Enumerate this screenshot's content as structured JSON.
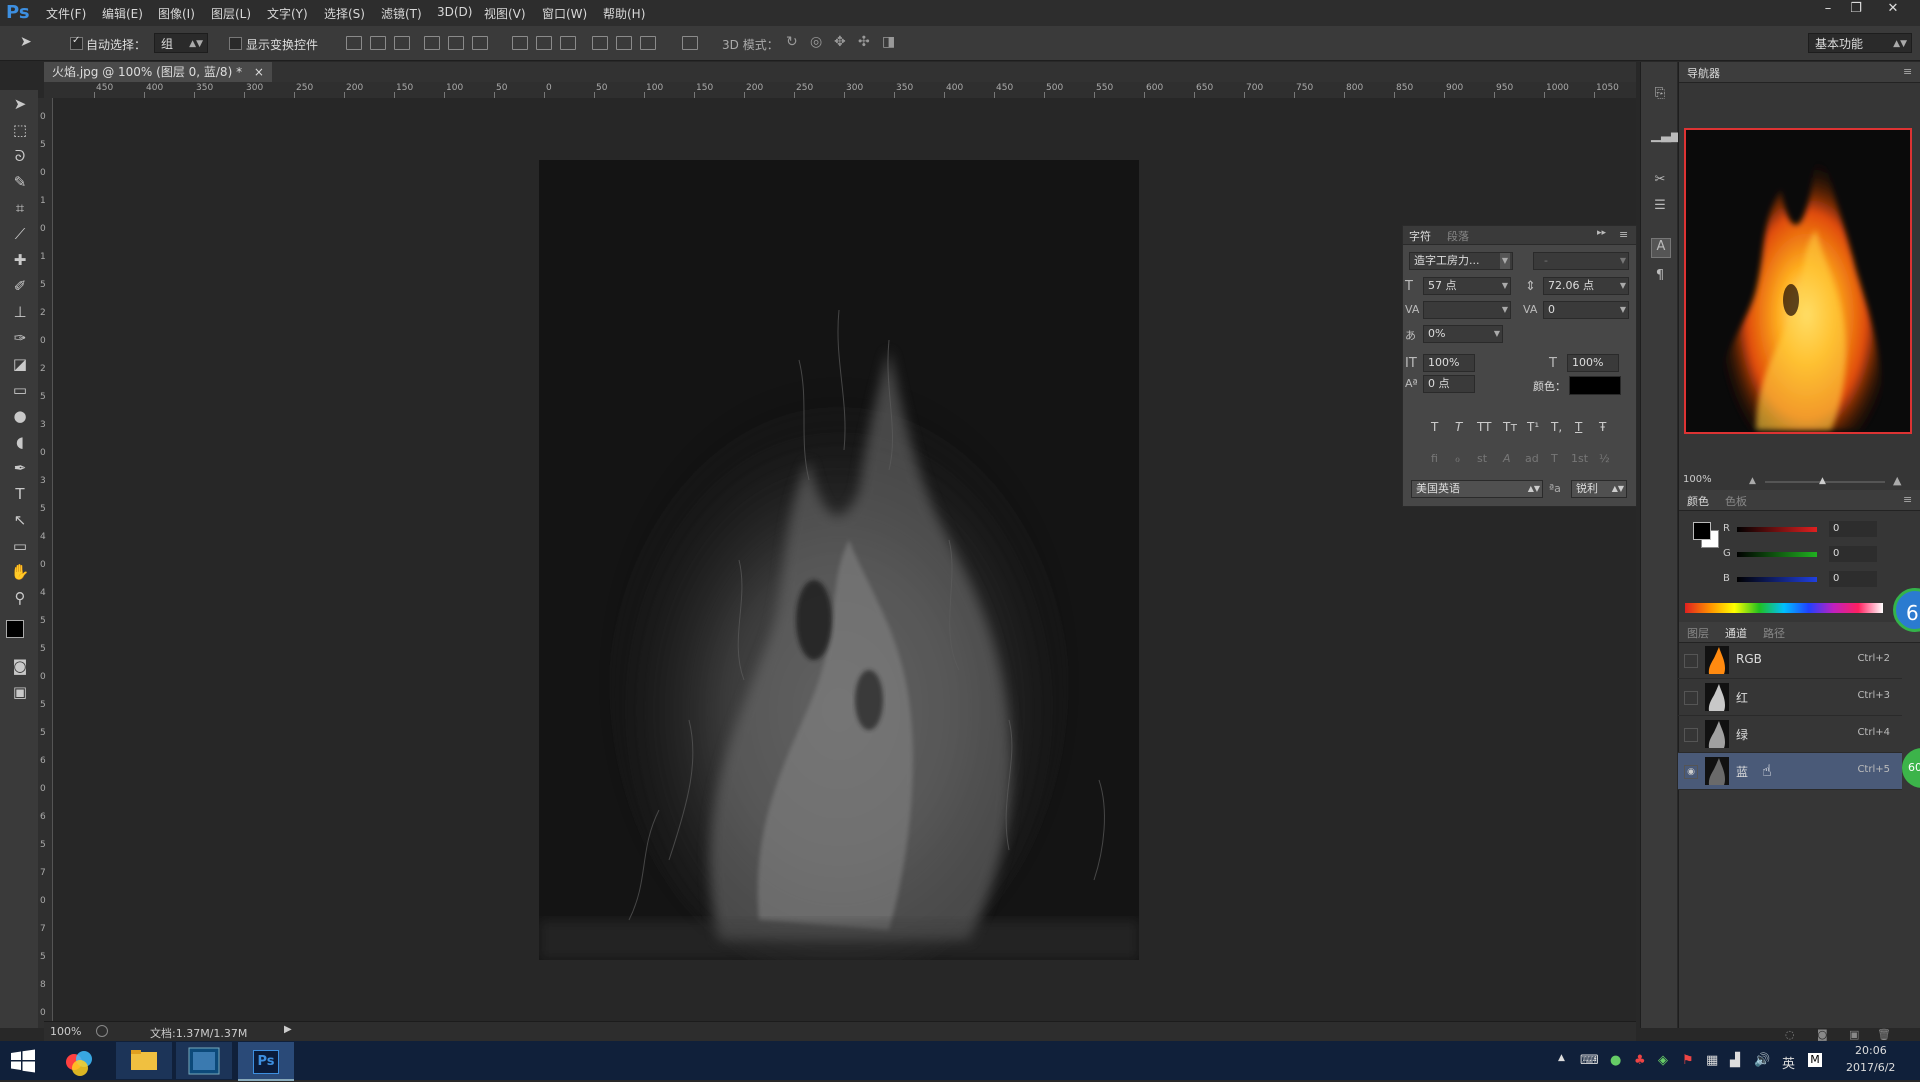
{
  "app": {
    "logo": "Ps",
    "menu": [
      "文件(F)",
      "编辑(E)",
      "图像(I)",
      "图层(L)",
      "文字(Y)",
      "选择(S)",
      "滤镜(T)",
      "3D(D)",
      "视图(V)",
      "窗口(W)",
      "帮助(H)"
    ],
    "window_controls": [
      "–",
      "❐",
      "✕"
    ]
  },
  "options_bar": {
    "auto_select_label": "自动选择：",
    "auto_select_value": "组",
    "show_transform_label": "显示变换控件",
    "mode_3d_label": "3D 模式：",
    "workspace_value": "基本功能"
  },
  "document": {
    "tab_title": "火焰.jpg @ 100% (图层 0, 蓝/8) *",
    "tab_close": "×",
    "zoom": "100%",
    "doc_size": "文档:1.37M/1.37M",
    "status_arrow": "▶"
  },
  "rulers": {
    "h_labels": [
      "450",
      "400",
      "350",
      "300",
      "250",
      "200",
      "150",
      "100",
      "50",
      "0",
      "50",
      "100",
      "150",
      "200",
      "250",
      "300",
      "350",
      "400",
      "450",
      "500",
      "550",
      "600",
      "650",
      "700",
      "750",
      "800",
      "850",
      "900",
      "950",
      "1000",
      "1050"
    ],
    "v_labels": [
      "0",
      "5",
      "0",
      "1",
      "0",
      "1",
      "5",
      "2",
      "0",
      "2",
      "5",
      "3",
      "0",
      "3",
      "5",
      "4",
      "0",
      "4",
      "5",
      "5",
      "0",
      "5",
      "5",
      "6",
      "0",
      "6",
      "5",
      "7",
      "0",
      "7",
      "5",
      "8",
      "0"
    ]
  },
  "character_panel": {
    "tabs": [
      "字符",
      "段落"
    ],
    "collapse": "▸▸",
    "menu": "≡",
    "font_family": "造字工房力...",
    "font_style": "-",
    "font_size": "57 点",
    "leading": "72.06 点",
    "kerning": "",
    "tracking": "0",
    "tsume": "0%",
    "vertical_scale": "100%",
    "horizontal_scale": "100%",
    "baseline_shift": "0 点",
    "color_label": "颜色：",
    "color_value": "#000000",
    "style_buttons": [
      "T",
      "T",
      "TT",
      "Tт",
      "T¹",
      "T,",
      "T",
      "Ŧ"
    ],
    "opentype_buttons": [
      "fi",
      "ℴ",
      "st",
      "A",
      "ad",
      "T",
      "1st",
      "½"
    ],
    "language": "美国英语",
    "aa_label": "ªa",
    "antialias": "锐利"
  },
  "navigator": {
    "title": "导航器",
    "zoom": "100%"
  },
  "color_panel": {
    "tabs": [
      "颜色",
      "色板"
    ],
    "channels": [
      {
        "label": "R",
        "value": "0",
        "color": "#e02020"
      },
      {
        "label": "G",
        "value": "0",
        "color": "#20b020"
      },
      {
        "label": "B",
        "value": "0",
        "color": "#2040e0"
      }
    ]
  },
  "channels_panel": {
    "tabs": [
      "图层",
      "通道",
      "路径"
    ],
    "rows": [
      {
        "name": "RGB",
        "shortcut": "Ctrl+2",
        "selected": false,
        "visible": false
      },
      {
        "name": "红",
        "shortcut": "Ctrl+3",
        "selected": false,
        "visible": false
      },
      {
        "name": "绿",
        "shortcut": "Ctrl+4",
        "selected": false,
        "visible": false
      },
      {
        "name": "蓝",
        "shortcut": "Ctrl+5",
        "selected": true,
        "visible": true
      }
    ],
    "badge_top": "6",
    "badge_bottom": "60"
  },
  "taskbar": {
    "clock_time": "20:06",
    "clock_date": "2017/6/2",
    "ime": "英",
    "app_labels": [
      "Ps"
    ]
  },
  "colors": {
    "accent_blue": "#3d8fe0",
    "fire_orange": "#ff8a10",
    "selected_row": "#4a5a78"
  }
}
